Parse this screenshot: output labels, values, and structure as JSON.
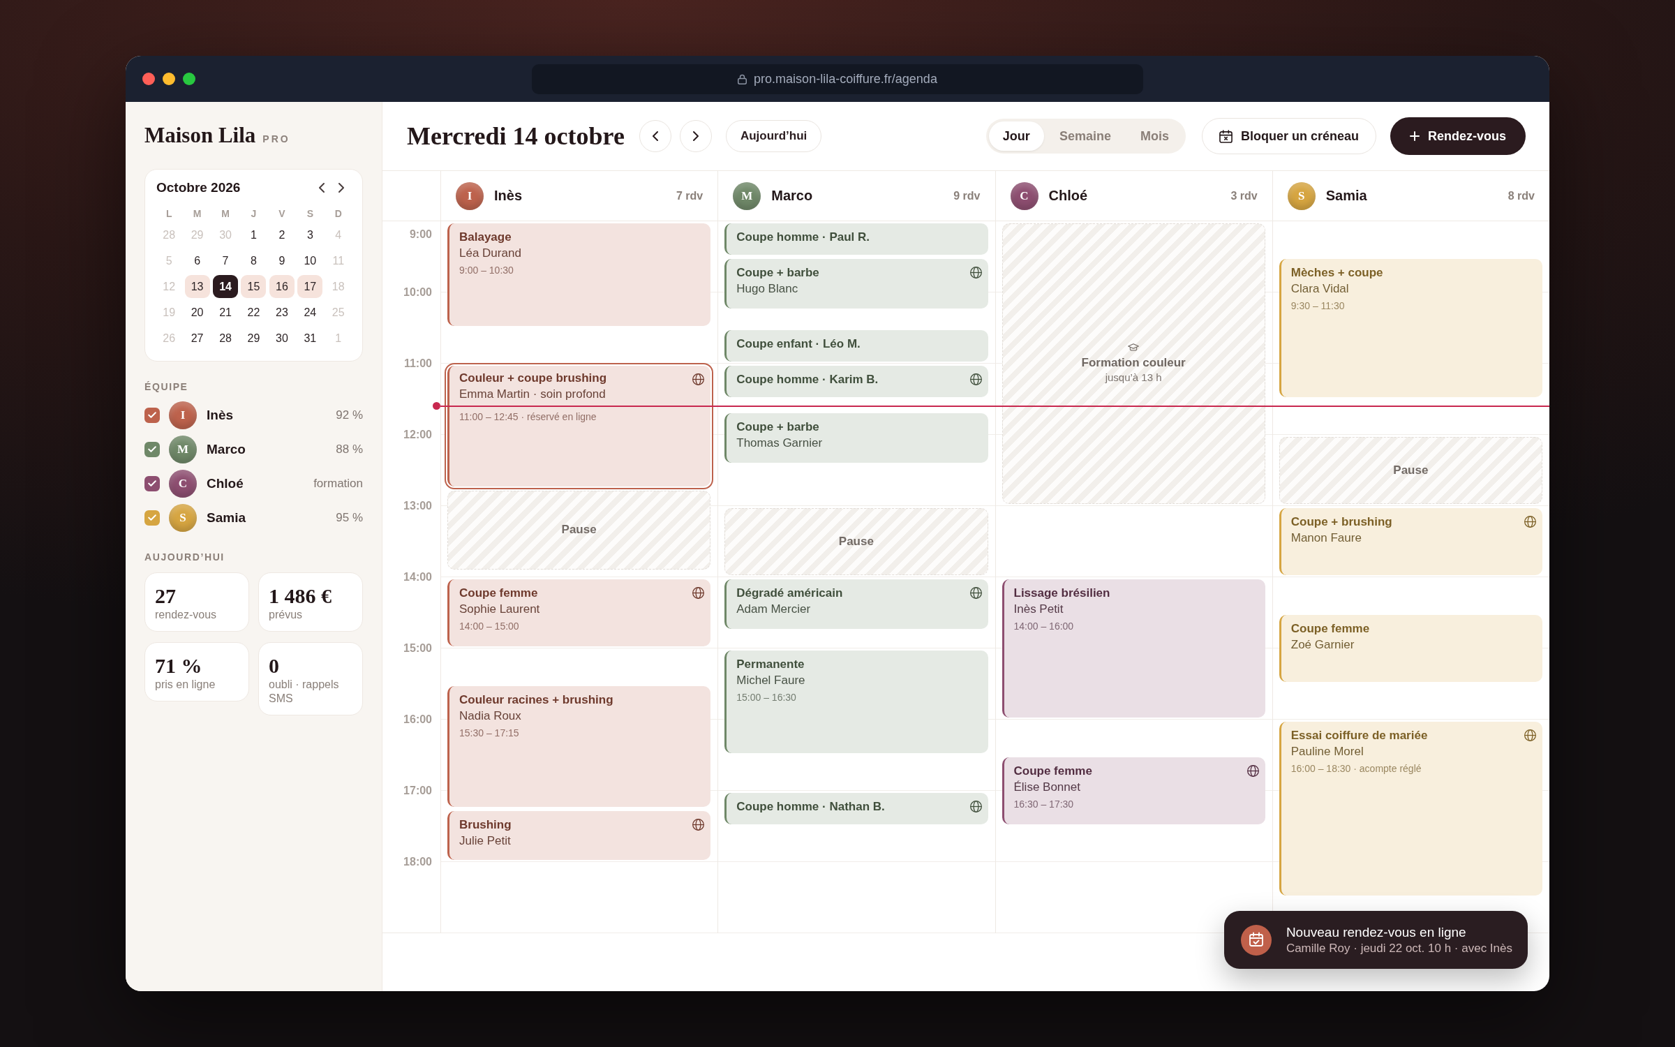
{
  "browser": {
    "url": "pro.maison-lila-coiffure.fr/agenda"
  },
  "sidebar": {
    "brand": {
      "name": "Maison Lila",
      "badge": "PRO"
    },
    "mini_calendar": {
      "title": "Octobre 2026",
      "weekdays": [
        "L",
        "M",
        "M",
        "J",
        "V",
        "S",
        "D"
      ],
      "weeks": [
        [
          {
            "label": "28",
            "muted": true,
            "in_week": false,
            "selected": false
          },
          {
            "label": "29",
            "muted": true,
            "in_week": false,
            "selected": false
          },
          {
            "label": "30",
            "muted": true,
            "in_week": false,
            "selected": false
          },
          {
            "label": "1",
            "muted": false,
            "in_week": false,
            "selected": false
          },
          {
            "label": "2",
            "muted": false,
            "in_week": false,
            "selected": false
          },
          {
            "label": "3",
            "muted": false,
            "in_week": false,
            "selected": false
          },
          {
            "label": "4",
            "muted": true,
            "in_week": false,
            "selected": false
          }
        ],
        [
          {
            "label": "5",
            "muted": true,
            "in_week": false,
            "selected": false
          },
          {
            "label": "6",
            "muted": false,
            "in_week": false,
            "selected": false
          },
          {
            "label": "7",
            "muted": false,
            "in_week": false,
            "selected": false
          },
          {
            "label": "8",
            "muted": false,
            "in_week": false,
            "selected": false
          },
          {
            "label": "9",
            "muted": false,
            "in_week": false,
            "selected": false
          },
          {
            "label": "10",
            "muted": false,
            "in_week": false,
            "selected": false
          },
          {
            "label": "11",
            "muted": true,
            "in_week": false,
            "selected": false
          }
        ],
        [
          {
            "label": "12",
            "muted": true,
            "in_week": false,
            "selected": false
          },
          {
            "label": "13",
            "muted": false,
            "in_week": true,
            "selected": false
          },
          {
            "label": "14",
            "muted": false,
            "in_week": true,
            "selected": true
          },
          {
            "label": "15",
            "muted": false,
            "in_week": true,
            "selected": false
          },
          {
            "label": "16",
            "muted": false,
            "in_week": true,
            "selected": false
          },
          {
            "label": "17",
            "muted": false,
            "in_week": true,
            "selected": false
          },
          {
            "label": "18",
            "muted": true,
            "in_week": false,
            "selected": false
          }
        ],
        [
          {
            "label": "19",
            "muted": true,
            "in_week": false,
            "selected": false
          },
          {
            "label": "20",
            "muted": false,
            "in_week": false,
            "selected": false
          },
          {
            "label": "21",
            "muted": false,
            "in_week": false,
            "selected": false
          },
          {
            "label": "22",
            "muted": false,
            "in_week": false,
            "selected": false
          },
          {
            "label": "23",
            "muted": false,
            "in_week": false,
            "selected": false
          },
          {
            "label": "24",
            "muted": false,
            "in_week": false,
            "selected": false
          },
          {
            "label": "25",
            "muted": true,
            "in_week": false,
            "selected": false
          }
        ],
        [
          {
            "label": "26",
            "muted": true,
            "in_week": false,
            "selected": false
          },
          {
            "label": "27",
            "muted": false,
            "in_week": false,
            "selected": false
          },
          {
            "label": "28",
            "muted": false,
            "in_week": false,
            "selected": false
          },
          {
            "label": "29",
            "muted": false,
            "in_week": false,
            "selected": false
          },
          {
            "label": "30",
            "muted": false,
            "in_week": false,
            "selected": false
          },
          {
            "label": "31",
            "muted": false,
            "in_week": false,
            "selected": false
          },
          {
            "label": "1",
            "muted": true,
            "in_week": false,
            "selected": false
          }
        ]
      ]
    },
    "team": {
      "heading": "ÉQUIPE",
      "members": [
        {
          "initial": "I",
          "name": "Inès",
          "stat": "92 %",
          "checked": true,
          "color": "#bd624c"
        },
        {
          "initial": "M",
          "name": "Marco",
          "stat": "88 %",
          "checked": true,
          "color": "#6f8868"
        },
        {
          "initial": "C",
          "name": "Chloé",
          "stat": "formation",
          "checked": true,
          "color": "#8d4e70"
        },
        {
          "initial": "S",
          "name": "Samia",
          "stat": "95 %",
          "checked": true,
          "color": "#d6a541"
        }
      ]
    },
    "today": {
      "heading": "AUJOURD’HUI",
      "stats": [
        {
          "value": "27",
          "label": "rendez-vous"
        },
        {
          "value": "1 486 €",
          "label": "prévus"
        },
        {
          "value": "71 %",
          "label": "pris en ligne"
        },
        {
          "value": "0",
          "label": "oubli · rappels SMS"
        }
      ]
    }
  },
  "toolbar": {
    "date_title": "Mercredi 14 octobre",
    "today_button": "Aujourd’hui",
    "views": [
      {
        "label": "Jour",
        "selected": true
      },
      {
        "label": "Semaine",
        "selected": false
      },
      {
        "label": "Mois",
        "selected": false
      }
    ],
    "block_button": "Bloquer un créneau",
    "new_button": "Rendez-vous"
  },
  "agenda": {
    "hours": [
      "9:00",
      "10:00",
      "11:00",
      "12:00",
      "13:00",
      "14:00",
      "15:00",
      "16:00",
      "17:00",
      "18:00"
    ],
    "columns": [
      {
        "initial": "I",
        "name": "Inès",
        "count": "7 rdv",
        "color": "#bd624c",
        "events": [
          {
            "kind": "appointment",
            "title": "Balayage",
            "client": "Léa Durand",
            "time": "9:00 – 10:30",
            "online": false,
            "selected": false
          },
          {
            "kind": "appointment",
            "title": "Couleur + coupe brushing",
            "client": "Emma Martin · soin profond",
            "time": "11:00 – 12:45 · réservé en ligne",
            "online": true,
            "selected": true
          },
          {
            "kind": "break",
            "label": "Pause",
            "selected": false
          },
          {
            "kind": "appointment",
            "title": "Coupe femme",
            "client": "Sophie Laurent",
            "time": "14:00 – 15:00",
            "online": true,
            "selected": false
          },
          {
            "kind": "appointment",
            "title": "Couleur racines + brushing",
            "client": "Nadia Roux",
            "time": "15:30 – 17:15",
            "online": false,
            "selected": false
          },
          {
            "kind": "appointment",
            "title": "Brushing",
            "client": "Julie Petit",
            "online": true,
            "selected": false
          }
        ]
      },
      {
        "initial": "M",
        "name": "Marco",
        "count": "9 rdv",
        "color": "#6f8868",
        "events": [
          {
            "kind": "appointment",
            "title": "Coupe homme · Paul R.",
            "online": false,
            "selected": false
          },
          {
            "kind": "appointment",
            "title": "Coupe + barbe",
            "client": "Hugo Blanc",
            "online": true,
            "selected": false
          },
          {
            "kind": "appointment",
            "title": "Coupe enfant · Léo M.",
            "online": false,
            "selected": false
          },
          {
            "kind": "appointment",
            "title": "Coupe homme · Karim B.",
            "online": true,
            "selected": false
          },
          {
            "kind": "appointment",
            "title": "Coupe + barbe",
            "client": "Thomas Garnier",
            "online": false,
            "selected": false
          },
          {
            "kind": "break",
            "label": "Pause",
            "selected": false
          },
          {
            "kind": "appointment",
            "title": "Dégradé américain",
            "client": "Adam Mercier",
            "online": true,
            "selected": false
          },
          {
            "kind": "appointment",
            "title": "Permanente",
            "client": "Michel Faure",
            "time": "15:00 – 16:30",
            "online": false,
            "selected": false
          },
          {
            "kind": "appointment",
            "title": "Coupe homme · Nathan B.",
            "online": true,
            "selected": false
          }
        ]
      },
      {
        "initial": "C",
        "name": "Chloé",
        "count": "3 rdv",
        "color": "#8d4e70",
        "events": [
          {
            "kind": "training",
            "title": "Formation couleur",
            "note": "jusqu’à 13 h",
            "selected": false
          },
          {
            "kind": "appointment",
            "title": "Lissage brésilien",
            "client": "Inès Petit",
            "time": "14:00 – 16:00",
            "online": false,
            "selected": false
          },
          {
            "kind": "appointment",
            "title": "Coupe femme",
            "client": "Élise Bonnet",
            "time": "16:30 – 17:30",
            "online": true,
            "selected": false
          }
        ]
      },
      {
        "initial": "S",
        "name": "Samia",
        "count": "8 rdv",
        "color": "#d6a541",
        "events": [
          {
            "kind": "appointment",
            "title": "Mèches + coupe",
            "client": "Clara Vidal",
            "time": "9:30 – 11:30",
            "online": false,
            "selected": false
          },
          {
            "kind": "break",
            "label": "Pause",
            "selected": false
          },
          {
            "kind": "appointment",
            "title": "Coupe + brushing",
            "client": "Manon Faure",
            "online": true,
            "selected": false
          },
          {
            "kind": "appointment",
            "title": "Coupe femme",
            "client": "Zoé Garnier",
            "online": false,
            "selected": false
          },
          {
            "kind": "appointment",
            "title": "Essai coiffure de mariée",
            "client": "Pauline Morel",
            "time": "16:00 – 18:30 · acompte réglé",
            "online": true,
            "selected": false
          }
        ]
      }
    ]
  },
  "toast": {
    "title": "Nouveau rendez-vous en ligne",
    "detail": "Camille Roy · jeudi 22 oct. 10 h · avec Inès"
  }
}
